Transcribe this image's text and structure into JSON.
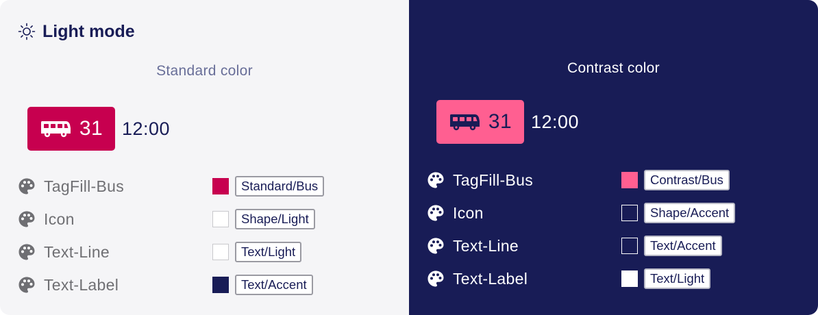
{
  "light": {
    "mode_title": "Light mode",
    "mode_icon": "sun-icon",
    "column_title": "Standard color",
    "tag": {
      "icon": "bus-icon",
      "line": "31",
      "fill": "#c7004f",
      "icon_color": "#ffffff"
    },
    "time": "12:00",
    "tokens": [
      {
        "name": "TagFill-Bus",
        "swatch": "#c7004f",
        "swatch_border": "#c7004f",
        "chip": "Standard/Bus"
      },
      {
        "name": "Icon",
        "swatch": "#ffffff",
        "swatch_border": "#c8c8cc",
        "chip": "Shape/Light"
      },
      {
        "name": "Text-Line",
        "swatch": "#ffffff",
        "swatch_border": "#c8c8cc",
        "chip": "Text/Light"
      },
      {
        "name": "Text-Label",
        "swatch": "#181c56",
        "swatch_border": "#181c56",
        "chip": "Text/Accent"
      }
    ]
  },
  "dark": {
    "column_title": "Contrast color",
    "tag": {
      "icon": "bus-icon",
      "line": "31",
      "fill": "#ff5f91",
      "icon_color": "#181c56"
    },
    "time": "12:00",
    "tokens": [
      {
        "name": "TagFill-Bus",
        "swatch": "#ff5f91",
        "swatch_border": "#ff5f91",
        "chip": "Contrast/Bus"
      },
      {
        "name": "Icon",
        "swatch": "#181c56",
        "swatch_border": "#ffffff",
        "chip": "Shape/Accent"
      },
      {
        "name": "Text-Line",
        "swatch": "#181c56",
        "swatch_border": "#ffffff",
        "chip": "Text/Accent"
      },
      {
        "name": "Text-Label",
        "swatch": "#ffffff",
        "swatch_border": "#ffffff",
        "chip": "Text/Light"
      }
    ]
  },
  "colors": {
    "light_bg": "#f5f5f7",
    "dark_bg": "#181c56",
    "accent": "#181c56",
    "muted_text": "#6f6f73",
    "palette_icon_light": "#6f6f73",
    "palette_icon_dark": "#ffffff"
  }
}
